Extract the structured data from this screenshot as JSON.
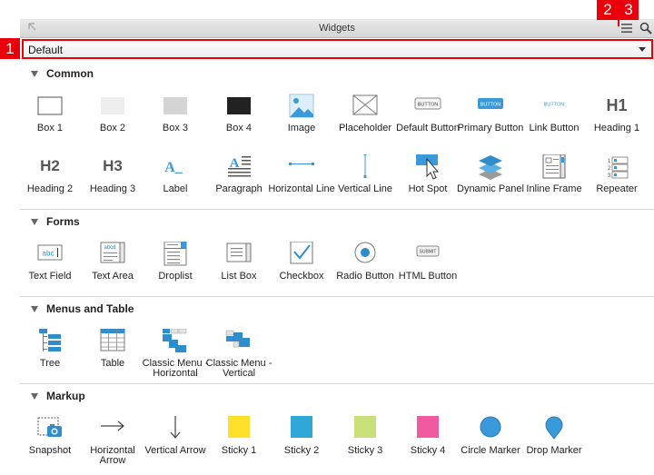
{
  "panel": {
    "title": "Widgets"
  },
  "markers": {
    "one": "1",
    "two": "2",
    "three": "3"
  },
  "library": {
    "selected": "Default"
  },
  "sections": {
    "common": {
      "title": "Common",
      "items": [
        "Box 1",
        "Box 2",
        "Box 3",
        "Box 4",
        "Image",
        "Placeholder",
        "Default Button",
        "Primary Button",
        "Link Button",
        "Heading 1",
        "Heading 2",
        "Heading 3",
        "Label",
        "Paragraph",
        "Horizontal Line",
        "Vertical Line",
        "Hot Spot",
        "Dynamic Panel",
        "Inline Frame",
        "Repeater"
      ]
    },
    "forms": {
      "title": "Forms",
      "items": [
        "Text Field",
        "Text Area",
        "Droplist",
        "List Box",
        "Checkbox",
        "Radio Button",
        "HTML Button"
      ]
    },
    "menus": {
      "title": "Menus and Table",
      "items": [
        "Tree",
        "Table",
        "Classic Menu - Horizontal",
        "Classic Menu - Vertical"
      ]
    },
    "markup": {
      "title": "Markup",
      "items": [
        "Snapshot",
        "Horizontal Arrow",
        "Vertical Arrow",
        "Sticky 1",
        "Sticky 2",
        "Sticky 3",
        "Sticky 4",
        "Circle Marker",
        "Drop Marker"
      ]
    }
  },
  "icon_text": {
    "button": "BUTTON",
    "h1": "H1",
    "h2": "H2",
    "h3": "H3",
    "label": "A_",
    "text_field": "abc",
    "text_area": "abcd",
    "submit": "SUBMIT"
  },
  "colors": {
    "accent": "#3a9ad9",
    "marker": "#e8000b",
    "sticky1": "#ffe02a",
    "sticky2": "#2fa8d8",
    "sticky3": "#c8e07a",
    "sticky4": "#ef5aa0"
  }
}
